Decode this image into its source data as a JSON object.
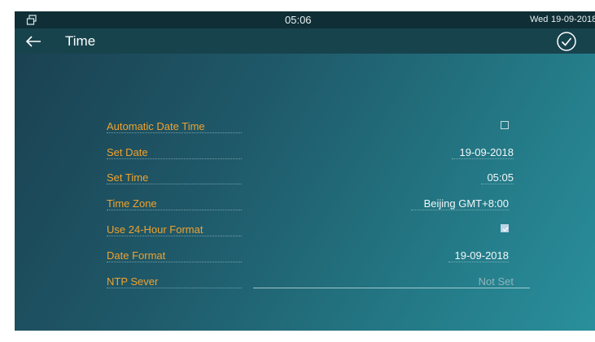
{
  "status_bar": {
    "icon": "multi-window-icon",
    "time": "05:06",
    "weekday": "Wed",
    "date": "19-09-2018"
  },
  "header": {
    "back_icon": "arrow-left-icon",
    "title": "Time",
    "confirm_icon": "check-circle-icon"
  },
  "settings": {
    "automatic_date_time": {
      "label": "Automatic Date Time",
      "checked": false
    },
    "set_date": {
      "label": "Set Date",
      "value": "19-09-2018"
    },
    "set_time": {
      "label": "Set Time",
      "value": "05:05"
    },
    "time_zone": {
      "label": "Time Zone",
      "value": "Beijing GMT+8:00"
    },
    "use_24_hour": {
      "label": "Use 24-Hour Format",
      "checked": true
    },
    "date_format": {
      "label": "Date Format",
      "value": "19-09-2018"
    },
    "ntp_server": {
      "label": "NTP Sever",
      "placeholder": "Not Set"
    }
  },
  "colors": {
    "label": "#f0a22e",
    "value": "#f2f7f8",
    "placeholder": "#8fb5bc",
    "status_bar_bg": "#0f2e36",
    "title_bar_bg": "#17434d"
  }
}
